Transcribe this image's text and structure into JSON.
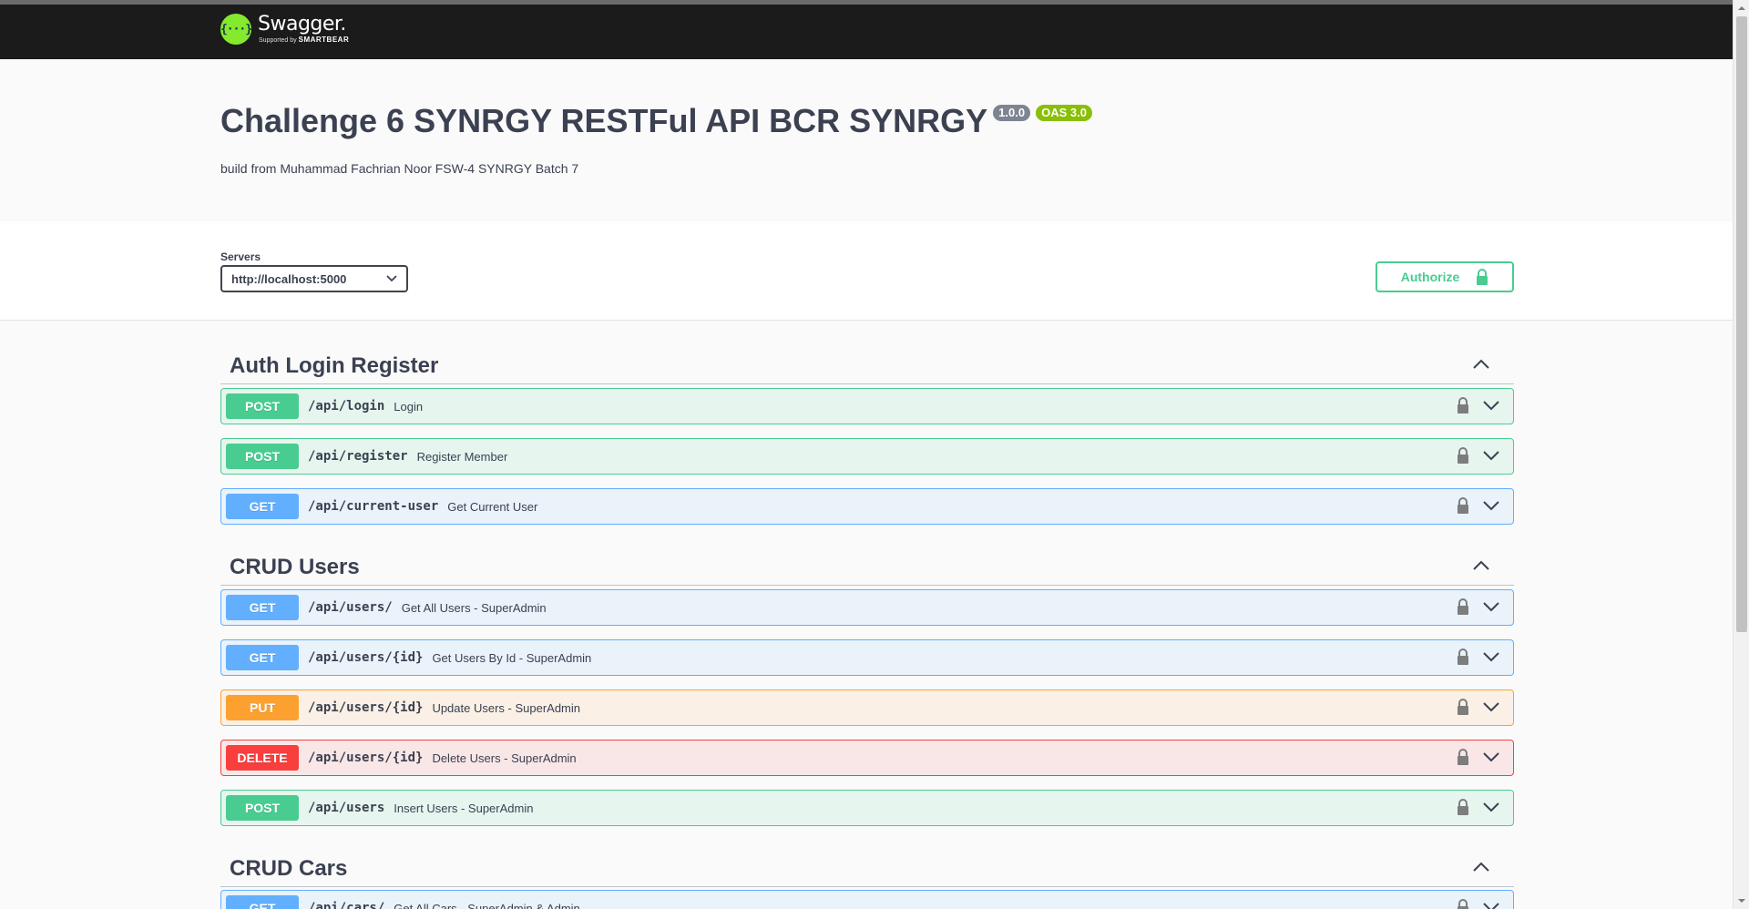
{
  "topbar": {
    "logo_glyph": "{···}",
    "logo_name": "Swagger.",
    "logo_sub_prefix": "Supported by",
    "logo_sub_brand": "SMARTBEAR"
  },
  "info": {
    "title": "Challenge 6 SYNRGY RESTFul API BCR SYNRGY",
    "version": "1.0.0",
    "oas": "OAS 3.0",
    "description": "build from Muhammad Fachrian Noor FSW-4 SYNRGY Batch 7"
  },
  "servers": {
    "label": "Servers",
    "selected": "http://localhost:5000"
  },
  "authorize": {
    "label": "Authorize"
  },
  "tags": [
    {
      "name": "Auth Login Register",
      "operations": [
        {
          "method": "POST",
          "path": "/api/login",
          "summary": "Login"
        },
        {
          "method": "POST",
          "path": "/api/register",
          "summary": "Register Member"
        },
        {
          "method": "GET",
          "path": "/api/current-user",
          "summary": "Get Current User"
        }
      ]
    },
    {
      "name": "CRUD Users",
      "operations": [
        {
          "method": "GET",
          "path": "/api/users/",
          "summary": "Get All Users - SuperAdmin"
        },
        {
          "method": "GET",
          "path": "/api/users/{id}",
          "summary": "Get Users By Id - SuperAdmin"
        },
        {
          "method": "PUT",
          "path": "/api/users/{id}",
          "summary": "Update Users - SuperAdmin"
        },
        {
          "method": "DELETE",
          "path": "/api/users/{id}",
          "summary": "Delete Users - SuperAdmin"
        },
        {
          "method": "POST",
          "path": "/api/users",
          "summary": "Insert Users - SuperAdmin"
        }
      ]
    },
    {
      "name": "CRUD Cars",
      "operations": [
        {
          "method": "GET",
          "path": "/api/cars/",
          "summary": "Get All Cars - SuperAdmin & Admin"
        }
      ]
    }
  ],
  "colors": {
    "post": "#49cc90",
    "get": "#61affe",
    "put": "#fca130",
    "delete": "#f93e3e",
    "topbar": "#1b1b1b",
    "text": "#3b4151"
  },
  "icons": [
    "swagger-logo-icon",
    "chevron-down-icon",
    "lock-icon",
    "chevron-up-icon"
  ]
}
